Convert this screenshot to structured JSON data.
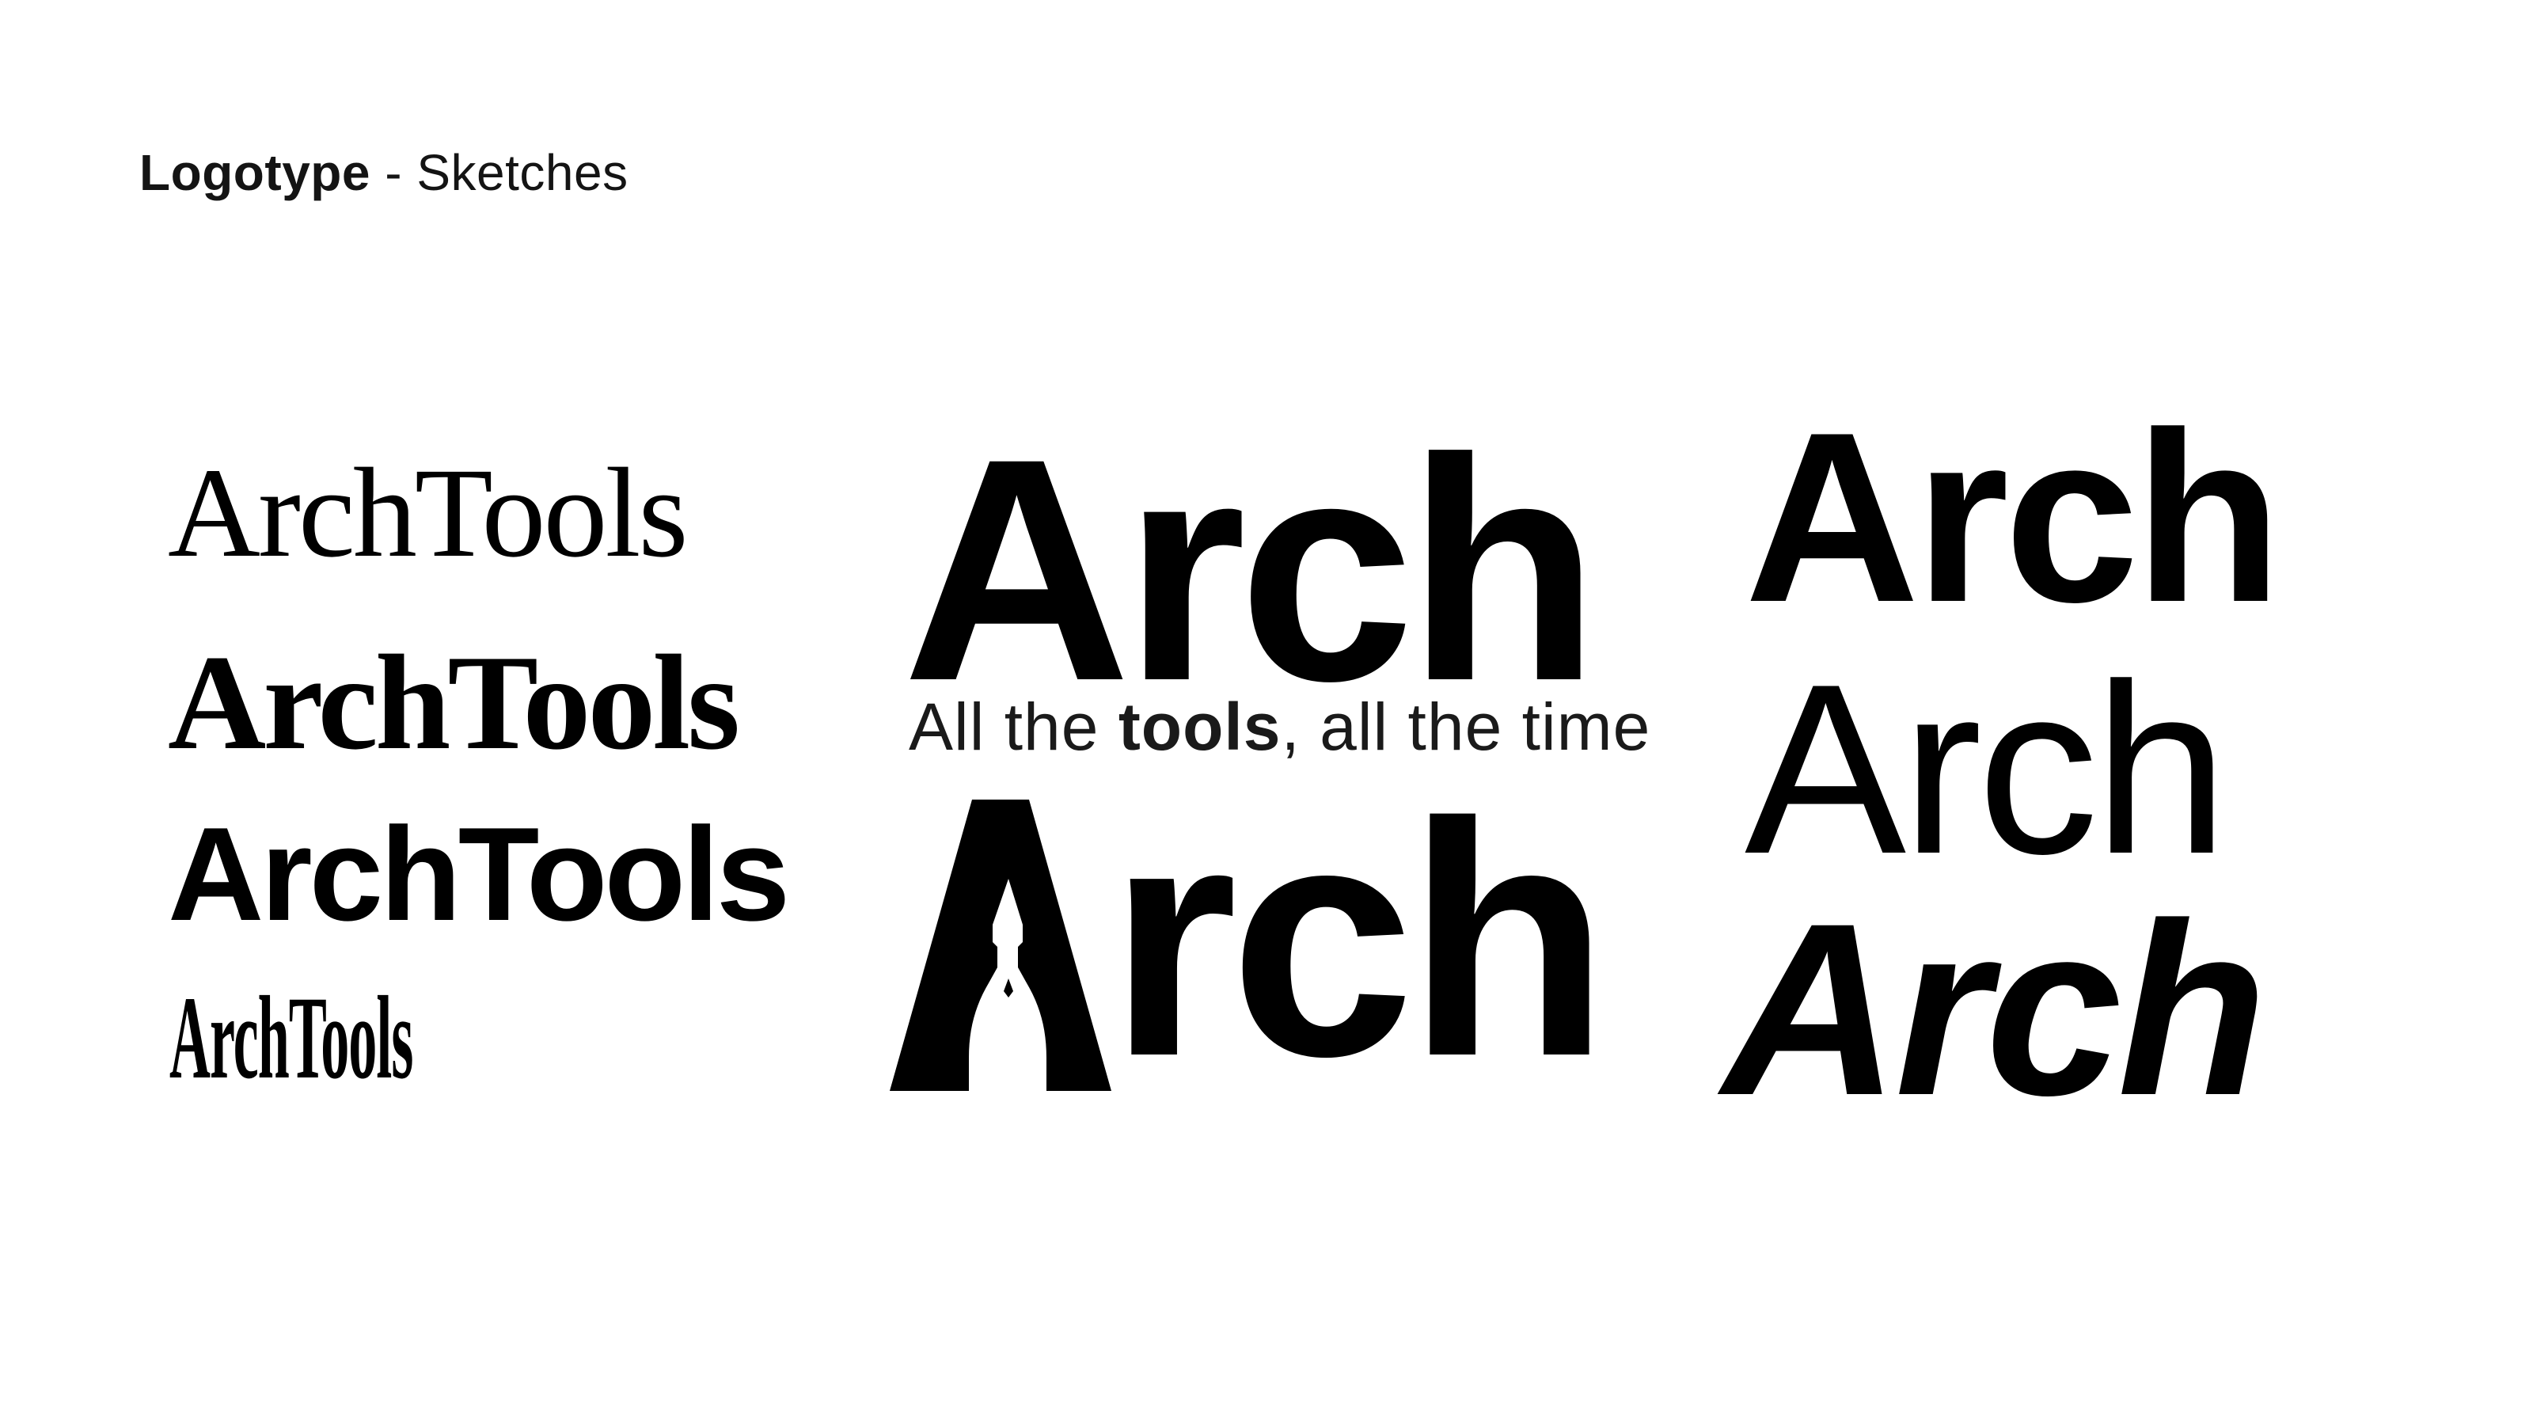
{
  "title": {
    "bold": "Logotype",
    "rest": " - Sketches"
  },
  "logos": {
    "archtools_1": "ArchTools",
    "archtools_2": "ArchTools",
    "archtools_3": "ArchTools",
    "archtools_4": "ArchTools",
    "arch_main": "Arch",
    "tagline": {
      "part1": "All the ",
      "bold": "tools",
      "part2": ", all the time"
    },
    "arch_tool_rest": "rch",
    "arch_right_1": "Arch",
    "arch_right_2": "Arch",
    "arch_right_3": "Arch"
  },
  "colors": {
    "ink": "#000000",
    "background": "#ffffff"
  }
}
